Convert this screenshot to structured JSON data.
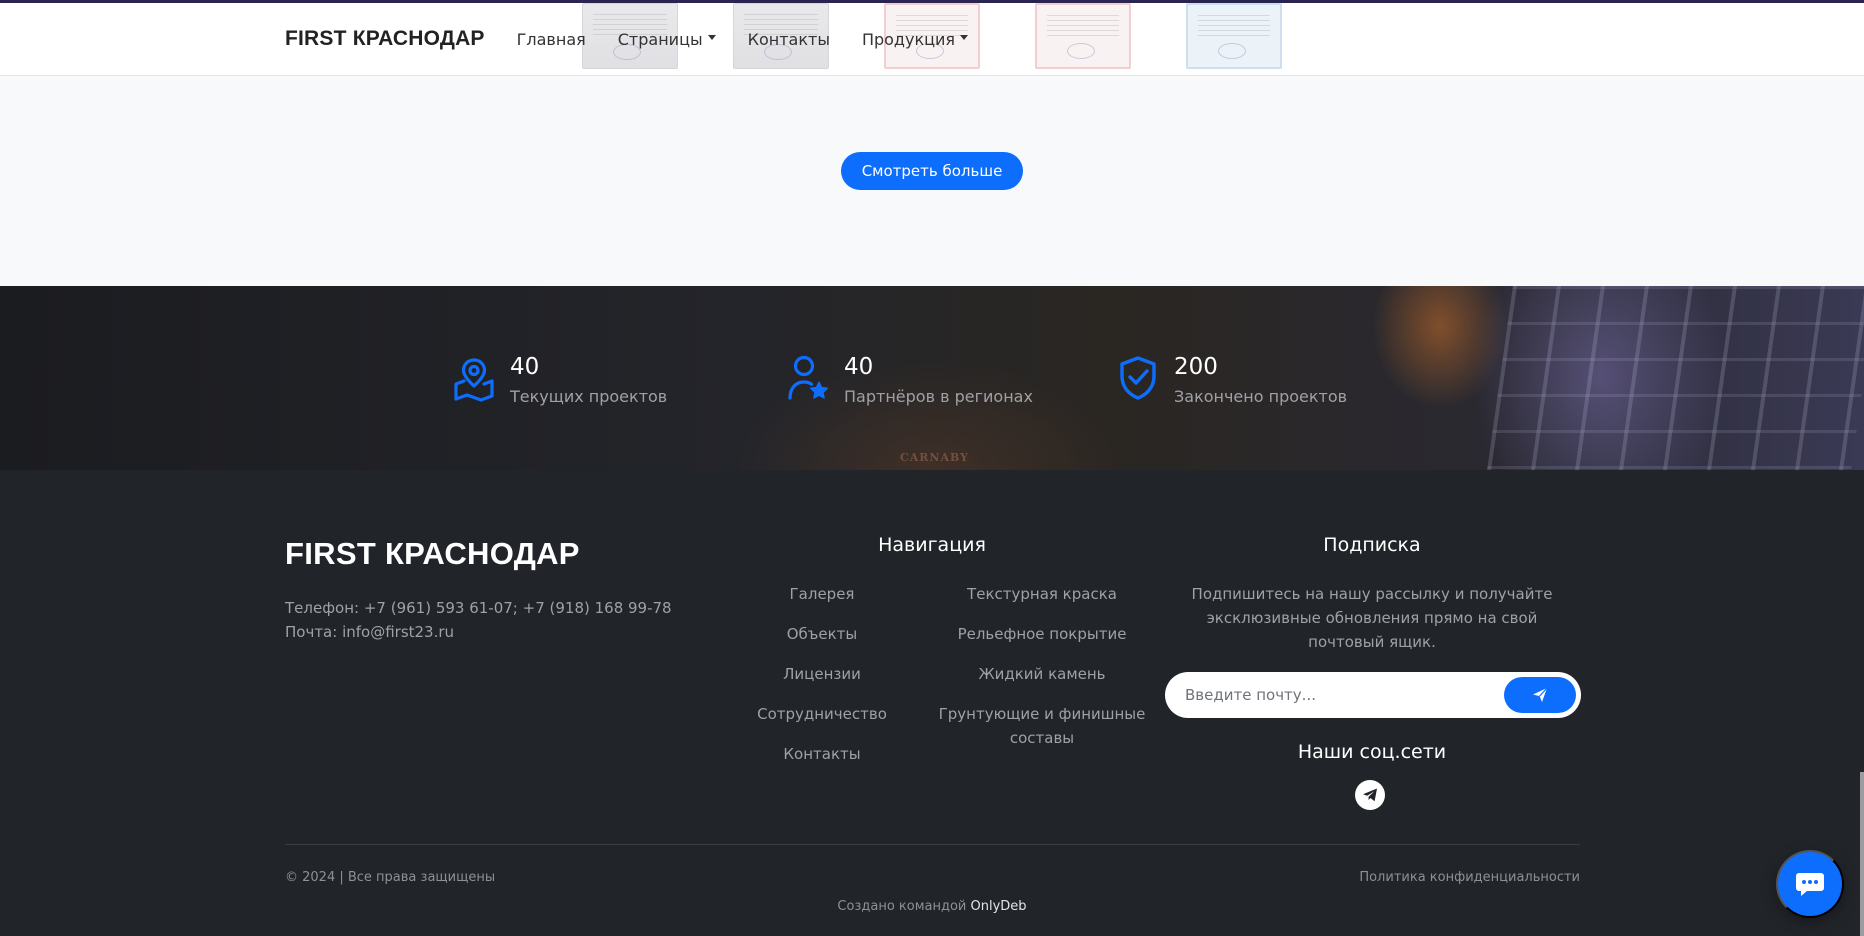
{
  "navbar": {
    "brand": "FIRST КРАСНОДАР",
    "links": [
      {
        "label": "Главная",
        "dropdown": false
      },
      {
        "label": "Страницы",
        "dropdown": true
      },
      {
        "label": "Контакты",
        "dropdown": false
      },
      {
        "label": "Продукция",
        "dropdown": true
      }
    ]
  },
  "gallery": {
    "more_button": "Смотреть больше"
  },
  "stats": [
    {
      "icon": "map-pin-icon",
      "value": "40",
      "label": "Текущих проектов"
    },
    {
      "icon": "user-star-icon",
      "value": "40",
      "label": "Партнёров в регионах"
    },
    {
      "icon": "shield-check-icon",
      "value": "200",
      "label": "Закончено проектов"
    }
  ],
  "footer": {
    "brand": "FIRST КРАСНОДАР",
    "phone": "Телефон: +7 (961) 593 61-07; +7 (918) 168 99-78",
    "email": "Почта: info@first23.ru",
    "navigation": {
      "heading": "Навигация",
      "col1": [
        "Галерея",
        "Объекты",
        "Лицензии",
        "Сотрудничество",
        "Контакты"
      ],
      "col2": [
        "Текстурная краска",
        "Рельефное покрытие",
        "Жидкий камень",
        "Грунтующие и финишные составы"
      ]
    },
    "subscribe": {
      "heading": "Подписка",
      "text": "Подпишитесь на нашу рассылку и получайте эксклюзивные обновления прямо на свой почтовый ящик.",
      "placeholder": "Введите почту...",
      "social_heading": "Наши соц.сети"
    },
    "copyright": "© 2024 | Все права защищены",
    "privacy": "Политика конфиденциальности",
    "credit_prefix": "Создано командой",
    "credit_team": "OnlyDeb"
  },
  "colors": {
    "accent": "#0d6efd",
    "footer_bg": "#212429",
    "muted_text": "#9ea1a8"
  }
}
